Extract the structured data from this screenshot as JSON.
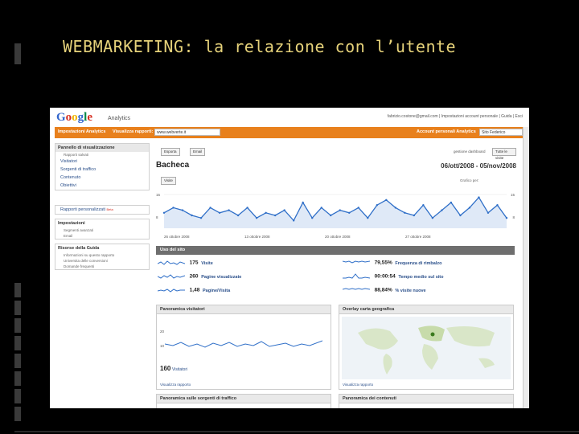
{
  "slide": {
    "title": "WEBMARKETING: la relazione con l’utente"
  },
  "colors": {
    "background": "#000000",
    "title": "#e6d27a",
    "ga_orange": "#e8801c",
    "chart_line": "#2f6fc8"
  },
  "ga": {
    "logo_text": "Google",
    "logo_sub": "Analytics",
    "account_line": "fabrizio.costone@gmail.com | Impostazioni account personale | Guida | Esci",
    "nav": {
      "settings": "Impostazioni Analytics",
      "view_reports": "Visualizza rapporti:",
      "site": "www.webverte.it",
      "personal": "Account personali Analytics",
      "account_select": "Sito Federico"
    },
    "sidebar": {
      "dashboard_header": "Pannello di visualizzazione",
      "saved_reports": "Rapporti salvati",
      "items": [
        "Visitatori",
        "Sorgenti di traffico",
        "Contenuto",
        "Obiettivi"
      ],
      "custom_reports": "Rapporti personalizzati",
      "custom_badge": "Beta",
      "settings_header": "Impostazioni",
      "settings_items": [
        "Segmenti avanzati",
        "Email"
      ],
      "help_header": "Risorse della Guida",
      "help_items": [
        "Informazioni su questo rapporto",
        "Universita delle conversioni",
        "Domande frequenti"
      ]
    },
    "main": {
      "export_label": "Esporta",
      "email_label": "Email",
      "beta_note": "gestione dashboard",
      "compare_label": "Tutte le visite",
      "page_title": "Bacheca",
      "date_range": "06/ott/2008 - 05/nov/2008",
      "metric_select": "Visite",
      "graph_label": "Grafico per:",
      "y_top_left": "15",
      "y_mid_left": "8",
      "y_top_right": "15",
      "y_mid_right": "8",
      "x_labels": [
        "26 ottobre 2008",
        "13 ottobre 2008",
        "20 ottobre 2008",
        "27 ottobre 2008"
      ],
      "site_usage": "Uso del sito",
      "metrics_left": [
        {
          "value": "175",
          "label": "Visite"
        },
        {
          "value": "260",
          "label": "Pagine visualizzate"
        },
        {
          "value": "1,48",
          "label": "Pagine/Visita"
        }
      ],
      "metrics_right": [
        {
          "value": "79,55%",
          "label": "Frequenza di rimbalzo"
        },
        {
          "value": "00:00:54",
          "label": "Tempo medio sul sito"
        },
        {
          "value": "88,84%",
          "label": "% visite nuove"
        }
      ],
      "panels": {
        "visitors_title": "Panoramica visitatori",
        "visitors_count": "160",
        "visitors_count_label": "Visitatori",
        "visitors_link": "Visualizza rapporto",
        "geo_title": "Overlay carta geografica",
        "geo_link": "Visualizza rapporto",
        "traffic_title": "Panoramica sulle sorgenti di traffico",
        "content_title": "Panoramica dei contenuti",
        "mini_y": [
          "20",
          "10"
        ]
      }
    }
  },
  "chart_data": {
    "type": "line",
    "title": "",
    "ylim": [
      0,
      15
    ],
    "series": [
      {
        "values": [
          6,
          8,
          7,
          5,
          4,
          8,
          6,
          7,
          5,
          8,
          4,
          6,
          5,
          7,
          3,
          10,
          4,
          8,
          5,
          7,
          6,
          8,
          4,
          9,
          11,
          8,
          6,
          5,
          9,
          4,
          7,
          10,
          5,
          8,
          12,
          6,
          9,
          4
        ]
      }
    ]
  }
}
